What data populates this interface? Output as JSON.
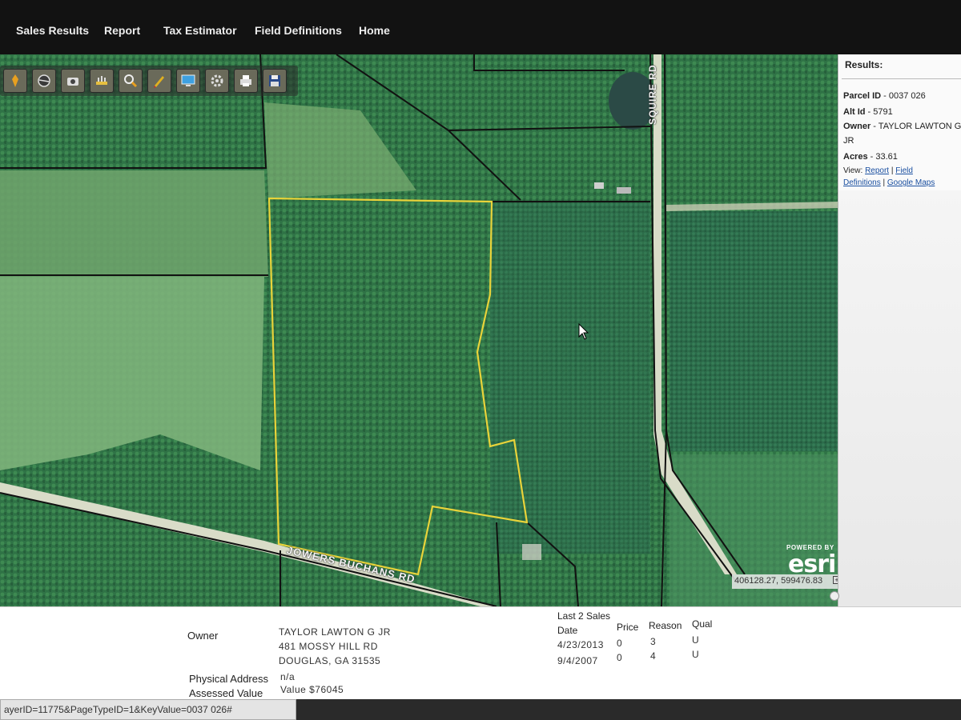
{
  "nav": {
    "items": [
      "Sales Results",
      "Report",
      "Tax Estimator",
      "Field Definitions",
      "Home"
    ]
  },
  "toolbar": {
    "tools": [
      {
        "icon": "pencil-marker-icon"
      },
      {
        "icon": "globe-icon"
      },
      {
        "icon": "camera-icon"
      },
      {
        "icon": "measure-icon"
      },
      {
        "icon": "zoom-icon"
      },
      {
        "icon": "draw-icon"
      },
      {
        "icon": "monitor-icon"
      },
      {
        "icon": "settings-icon"
      },
      {
        "icon": "print-icon"
      },
      {
        "icon": "save-icon"
      }
    ]
  },
  "map": {
    "street_vertical": "SQUIRE RD",
    "street_diagonal": "JOWERS BUCHANS RD",
    "powered_by": "POWERED BY",
    "esri": "esri",
    "coordinates": "406128.27, 599476.83",
    "parcel_color": "#e9d33a",
    "line_color": "#111111"
  },
  "results": {
    "title": "Results:",
    "parcel_label": "Parcel ID",
    "parcel_value": " - 0037 026",
    "alt_label": "Alt Id",
    "alt_value": " - 5791",
    "owner_label": "Owner",
    "owner_value": " - TAYLOR LAWTON G",
    "owner_cont": "JR",
    "acres_label": "Acres",
    "acres_value": " - 33.61",
    "view_label": "View: ",
    "report_link": "Report",
    "field_link": "Field",
    "definitions_link": "Definitions",
    "google_link": "Google Maps"
  },
  "info": {
    "owner_label": "Owner",
    "owner_name": "TAYLOR LAWTON G JR",
    "owner_addr1": "481 MOSSY HILL RD",
    "owner_addr2": "DOUGLAS, GA 31535",
    "phys_label": "Physical Address",
    "phys_value": "n/a",
    "assessed_label": "Assessed Value",
    "assessed_value": "Value $76045",
    "sales_title": "Last 2 Sales",
    "sales_headers": [
      "Date",
      "Price",
      "Reason",
      "Qual"
    ],
    "sales": [
      {
        "date": "4/23/2013",
        "price": "0",
        "reason": "3",
        "qual": "U"
      },
      {
        "date": "9/4/2007",
        "price": "0",
        "reason": "4",
        "qual": "U"
      }
    ]
  },
  "status": {
    "url": "ayerID=11775&PageTypeID=1&KeyValue=0037  026#"
  }
}
